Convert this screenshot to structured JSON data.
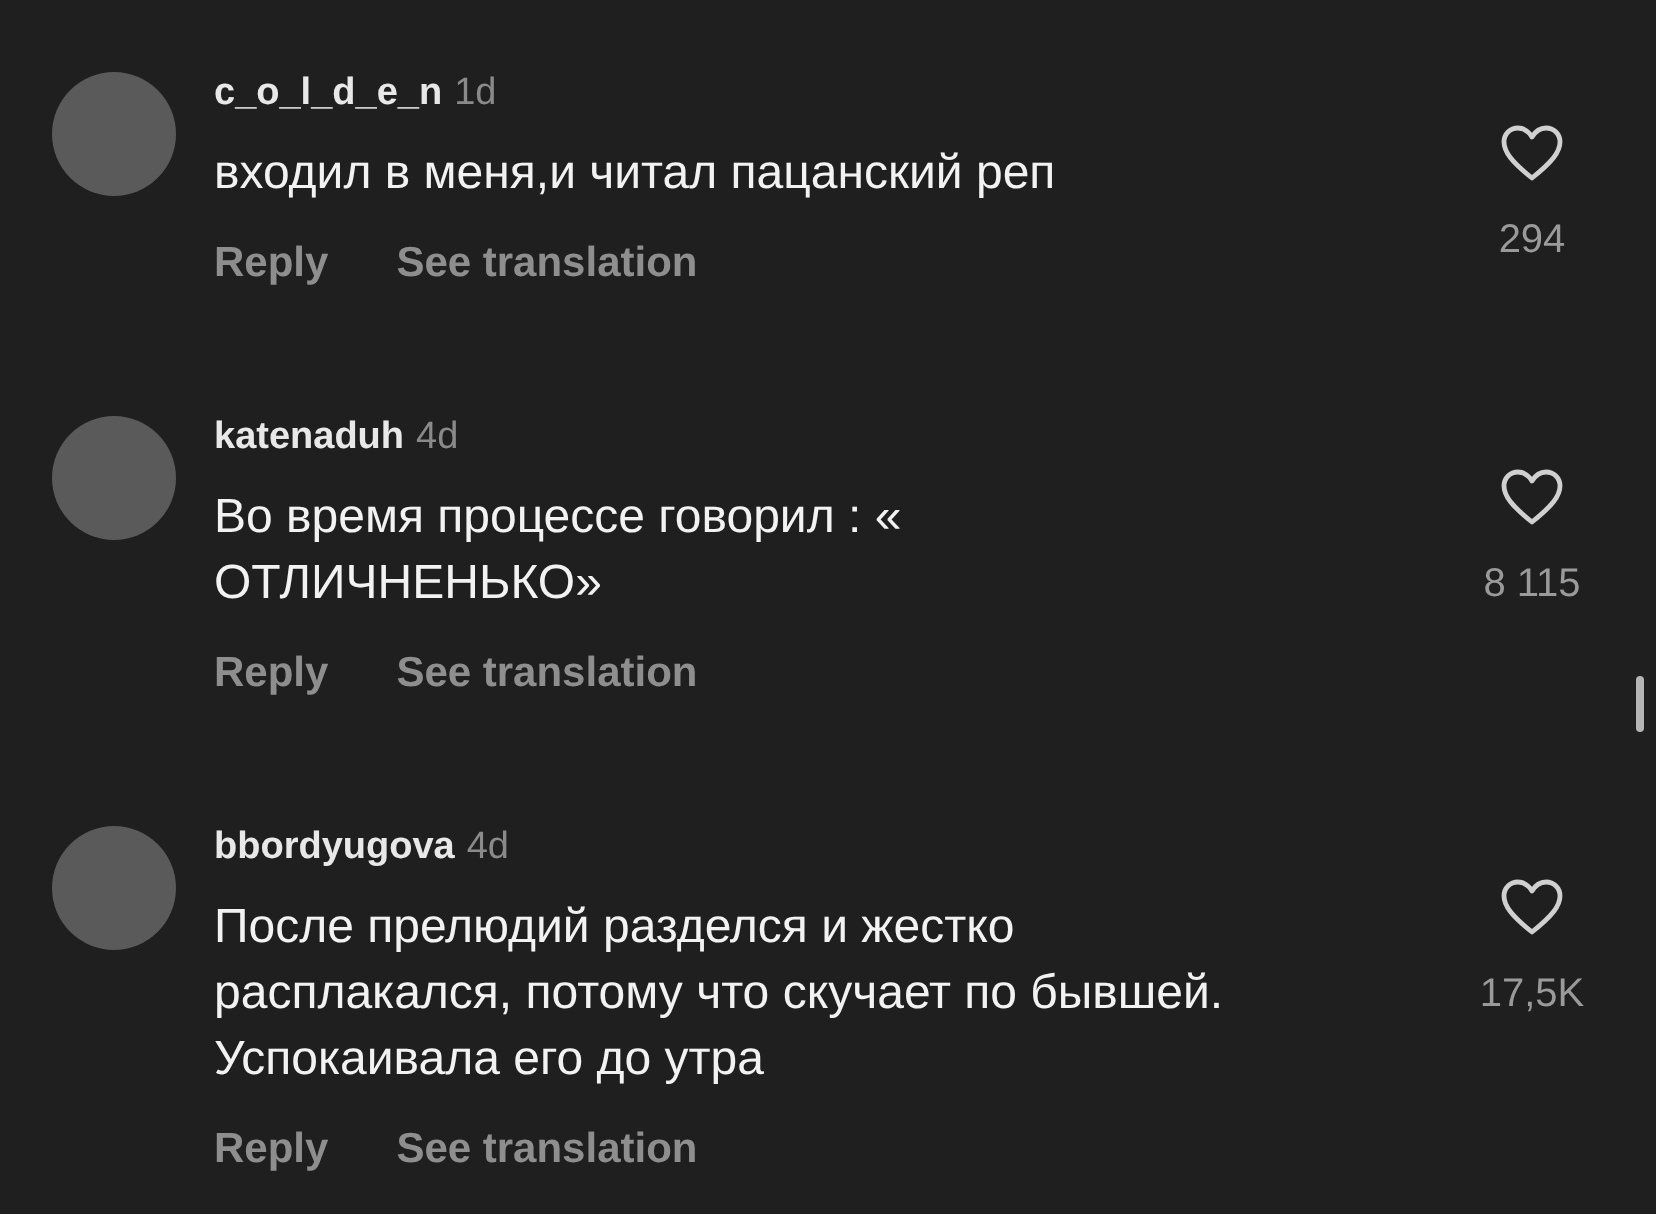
{
  "comments": [
    {
      "username": "c_o_l_d_e_n",
      "time": "1d",
      "text": "входил в меня,и читал пацанский реп",
      "reply": "Reply",
      "translate": "See translation",
      "likes": "294"
    },
    {
      "username": "katenaduh",
      "time": "4d",
      "text": "Во время процессе говорил : « ОТЛИЧНЕНЬКО»",
      "reply": "Reply",
      "translate": "See translation",
      "likes": "8 115"
    },
    {
      "username": "bbordyugova",
      "time": "4d",
      "text": "После прелюдий разделся и жестко расплакался, потому что скучает по бывшей. Успокаивала его до утра",
      "reply": "Reply",
      "translate": "See translation",
      "likes": "17,5K"
    }
  ]
}
